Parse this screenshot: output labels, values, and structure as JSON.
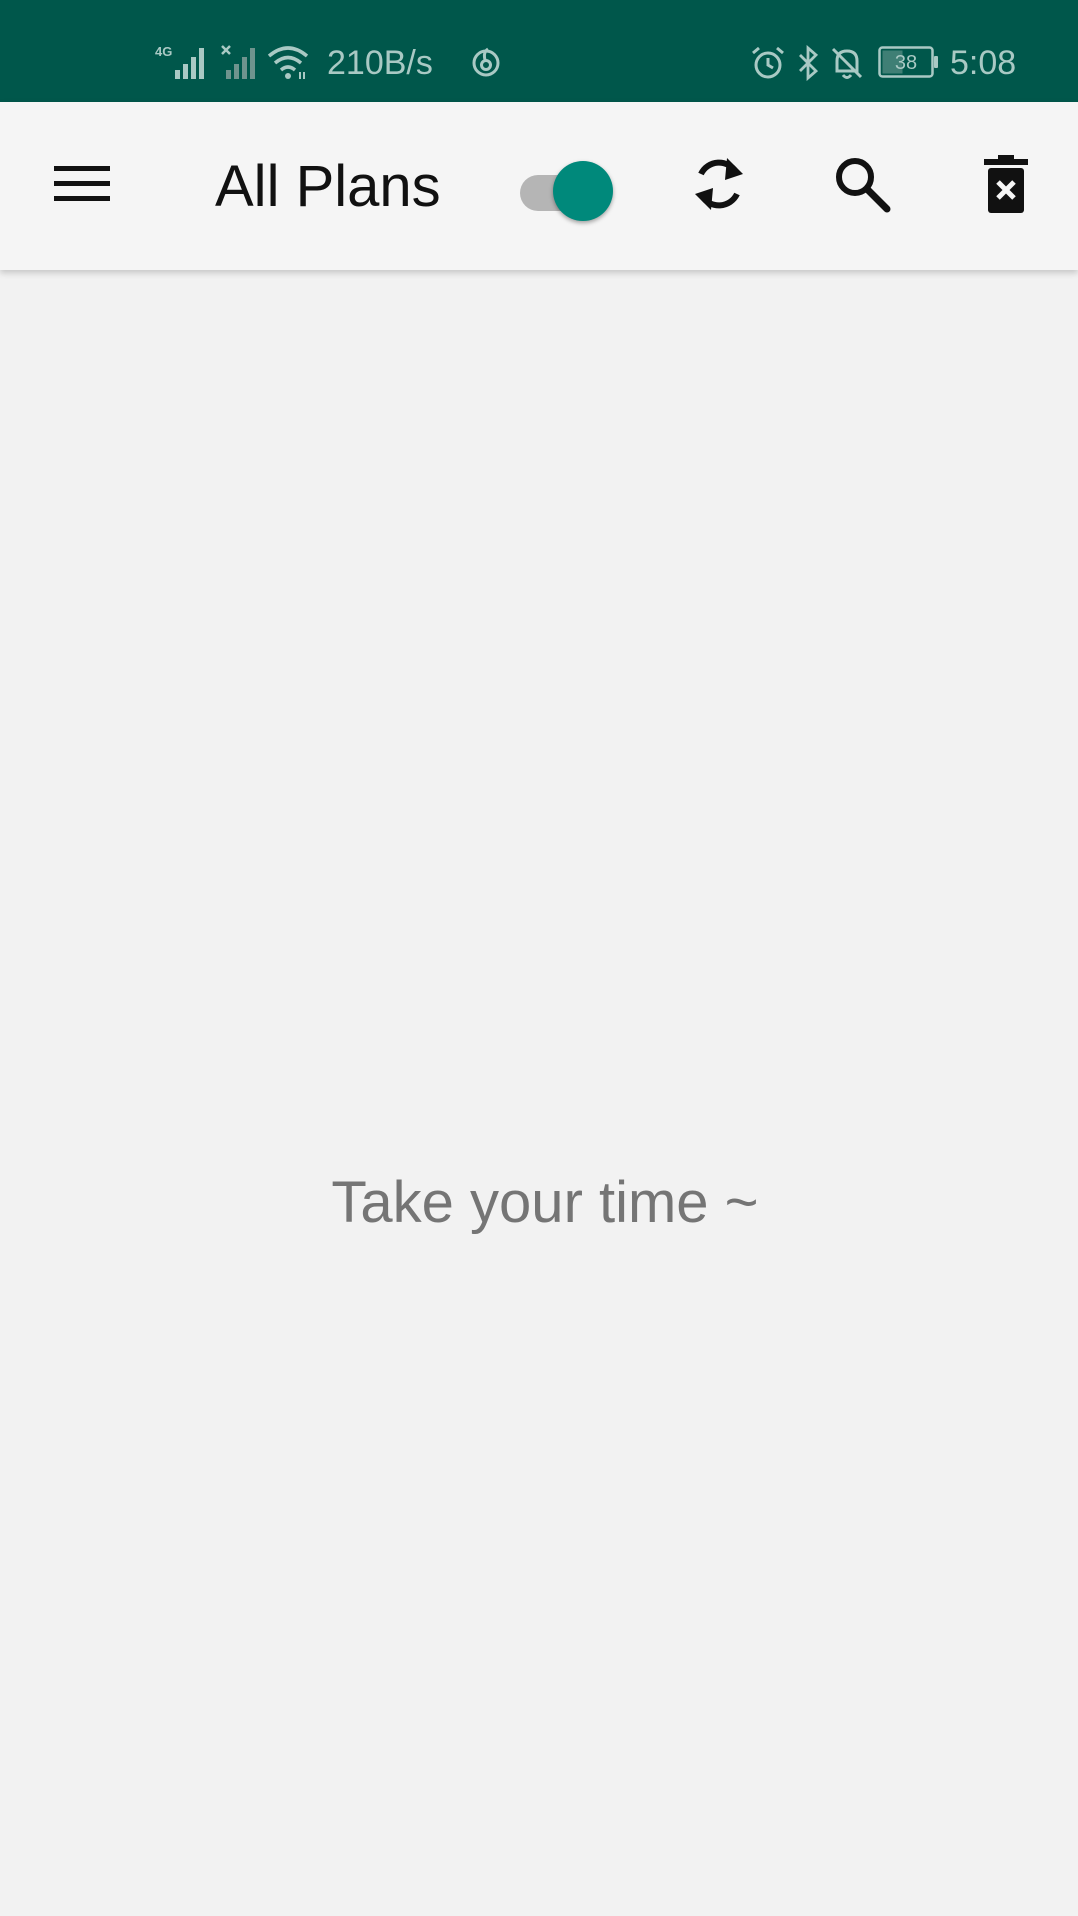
{
  "status_bar": {
    "network_type": "4G",
    "speed": "210B/s",
    "battery_level": "38",
    "time": "5:08",
    "background_color": "#00574b",
    "icons": [
      "signal-4g-icon",
      "signal-no-sim-icon",
      "wifi-icon",
      "netease-music-icon",
      "alarm-icon",
      "bluetooth-icon",
      "notifications-off-icon",
      "battery-icon"
    ]
  },
  "toolbar": {
    "title": "All Plans",
    "menu_icon": "hamburger-menu-icon",
    "toggle_on": true,
    "sync_icon": "sync-icon",
    "search_icon": "search-icon",
    "delete_icon": "delete-forever-icon",
    "accent_color": "#00897b"
  },
  "main": {
    "empty_message": "Take your time ~"
  }
}
